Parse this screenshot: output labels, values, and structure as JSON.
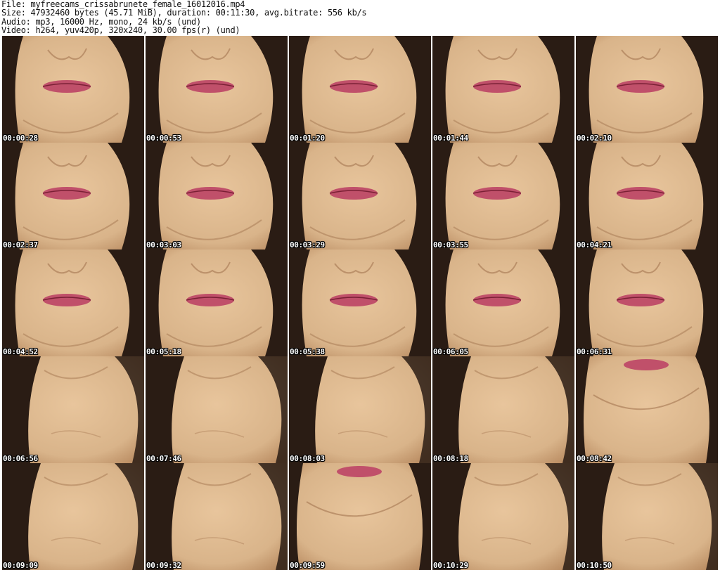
{
  "header": {
    "file": "File: myfreecams_crissabrunete_female_16012016.mp4",
    "size": "Size: 47932460 bytes (45.71 MiB), duration: 00:11:30, avg.bitrate: 556 kb/s",
    "audio": "Audio: mp3, 16000 Hz, mono, 24 kb/s (und)",
    "video": "Video: h264, yuv420p, 320x240, 30.00 fps(r) (und)"
  },
  "thumbnails": [
    {
      "timestamp": "00:00:28",
      "scene": "face"
    },
    {
      "timestamp": "00:00:53",
      "scene": "face"
    },
    {
      "timestamp": "00:01:20",
      "scene": "face"
    },
    {
      "timestamp": "00:01:44",
      "scene": "face"
    },
    {
      "timestamp": "00:02:10",
      "scene": "face"
    },
    {
      "timestamp": "00:02:37",
      "scene": "face"
    },
    {
      "timestamp": "00:03:03",
      "scene": "face"
    },
    {
      "timestamp": "00:03:29",
      "scene": "face"
    },
    {
      "timestamp": "00:03:55",
      "scene": "face"
    },
    {
      "timestamp": "00:04:21",
      "scene": "face"
    },
    {
      "timestamp": "00:04:52",
      "scene": "face"
    },
    {
      "timestamp": "00:05:18",
      "scene": "face"
    },
    {
      "timestamp": "00:05:38",
      "scene": "face"
    },
    {
      "timestamp": "00:06:05",
      "scene": "face"
    },
    {
      "timestamp": "00:06:31",
      "scene": "face"
    },
    {
      "timestamp": "00:06:56",
      "scene": "neck"
    },
    {
      "timestamp": "00:07:46",
      "scene": "neck"
    },
    {
      "timestamp": "00:08:03",
      "scene": "neck"
    },
    {
      "timestamp": "00:08:18",
      "scene": "neck"
    },
    {
      "timestamp": "00:08:42",
      "scene": "chin"
    },
    {
      "timestamp": "00:09:09",
      "scene": "neck"
    },
    {
      "timestamp": "00:09:32",
      "scene": "neck"
    },
    {
      "timestamp": "00:09:59",
      "scene": "chin"
    },
    {
      "timestamp": "00:10:29",
      "scene": "neck"
    },
    {
      "timestamp": "00:10:50",
      "scene": "neck"
    }
  ],
  "colors": {
    "skin": "#d9b48a",
    "skin_shadow": "#b88a60",
    "lips": "#c0506a",
    "hair": "#2a1c14",
    "background": "#ffffff"
  }
}
